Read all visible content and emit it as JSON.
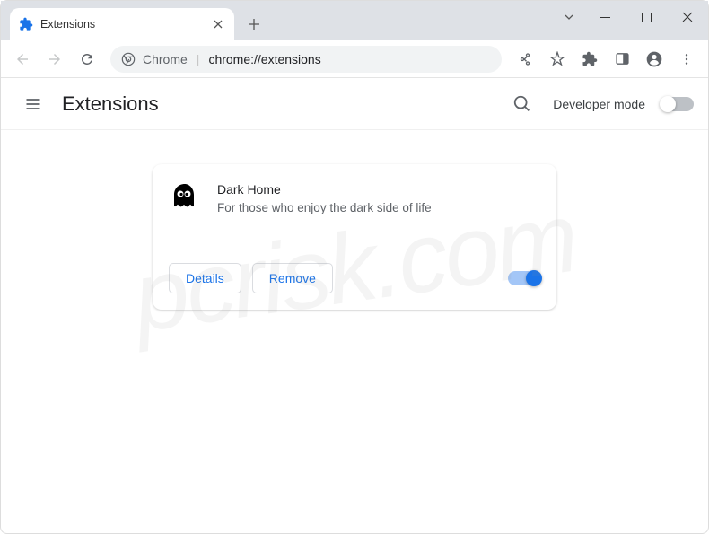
{
  "tab": {
    "title": "Extensions"
  },
  "address": {
    "prefix": "Chrome",
    "url": "chrome://extensions"
  },
  "page": {
    "title": "Extensions",
    "developer_mode_label": "Developer mode"
  },
  "extension": {
    "name": "Dark Home",
    "description": "For those who enjoy the dark side of life",
    "details_label": "Details",
    "remove_label": "Remove",
    "enabled": true
  },
  "watermark": "pcrisk.com"
}
